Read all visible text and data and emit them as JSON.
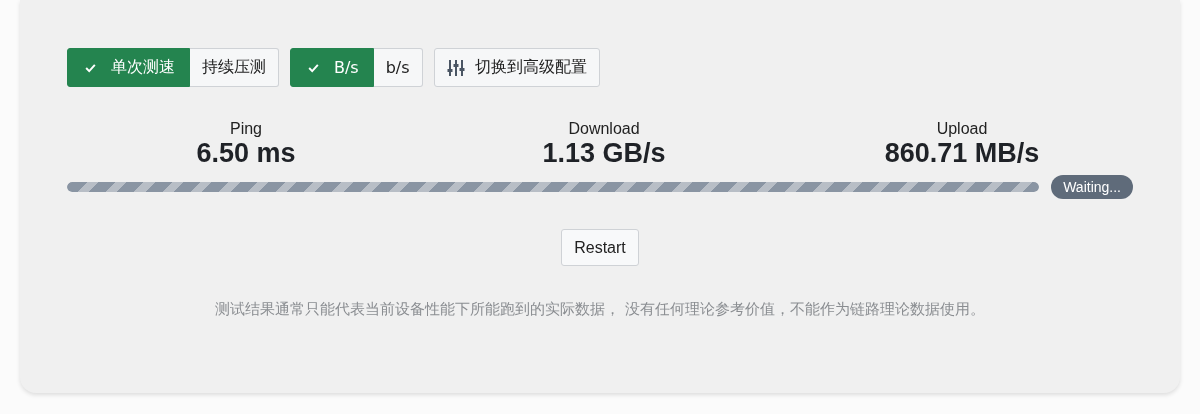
{
  "mode_toggle": [
    {
      "label": "单次测速",
      "selected": true
    },
    {
      "label": "持续压测",
      "selected": false
    }
  ],
  "unit_toggle": [
    {
      "label": "B/s",
      "selected": true
    },
    {
      "label": "b/s",
      "selected": false
    }
  ],
  "advanced_button": {
    "label": "切换到高级配置"
  },
  "metrics": [
    {
      "label": "Ping",
      "value": "6.50 ms"
    },
    {
      "label": "Download",
      "value": "1.13 GB/s"
    },
    {
      "label": "Upload",
      "value": "860.71 MB/s"
    }
  ],
  "progress": {
    "level": 1,
    "status": "Waiting..."
  },
  "restart_button": {
    "label": "Restart"
  },
  "note": "测试结果通常只能代表当前设备性能下所能跑到的实际数据， 没有任何理论参考价值，不能作为链路理论数据使用。"
}
